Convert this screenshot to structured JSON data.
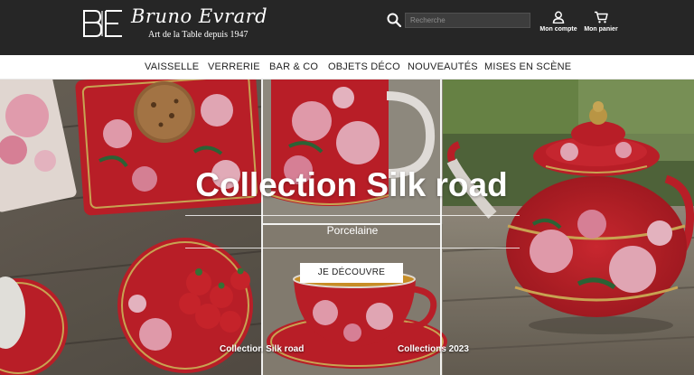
{
  "header": {
    "brand_name": "Bruno Evrard",
    "brand_tagline": "Art de la Table depuis 1947",
    "search": {
      "placeholder": "Recherche"
    },
    "account_label": "Mon compte",
    "cart_label": "Mon panier"
  },
  "nav": {
    "items": [
      {
        "label": "VAISSELLE"
      },
      {
        "label": "VERRERIE"
      },
      {
        "label": "BAR & CO"
      },
      {
        "label": "OBJETS DÉCO"
      },
      {
        "label": "NOUVEAUTÉS"
      },
      {
        "label": "MISES EN SCÈNE"
      }
    ]
  },
  "hero": {
    "title": "Collection Silk road",
    "subtitle": "Porcelaine",
    "cta_label": "JE DÉCOUVRE",
    "panel_captions": [
      "Collection Silk road",
      "Collections 2023"
    ]
  },
  "colors": {
    "header_bg": "#262626",
    "porcelain_red": "#c8212b",
    "wood": "#6e655a",
    "floral_pink": "#f2a7b8",
    "gold": "#c9a24a"
  }
}
